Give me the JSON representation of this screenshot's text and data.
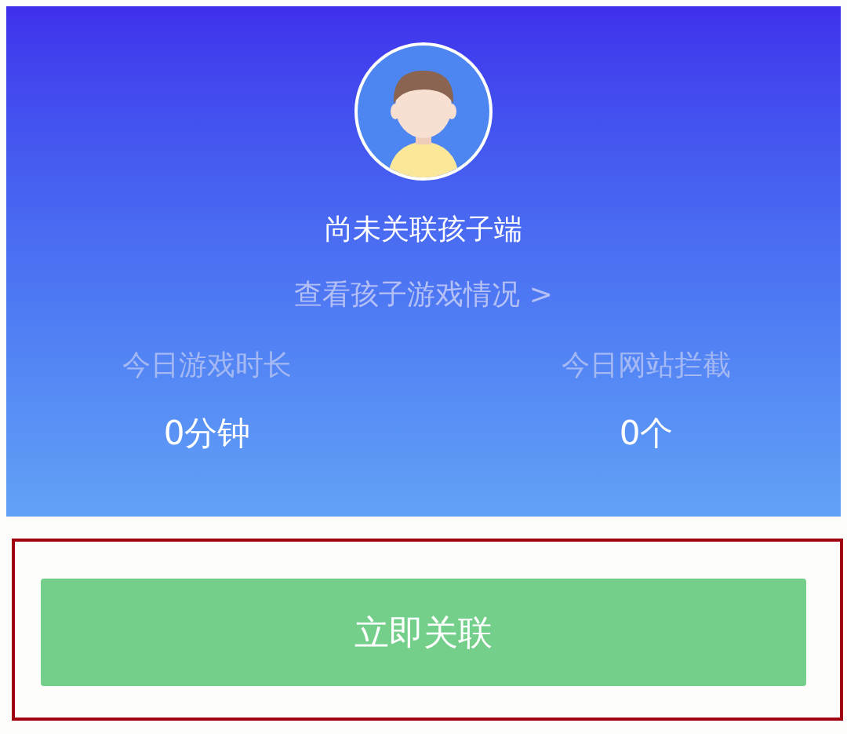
{
  "profile": {
    "status": "尚未关联孩子端",
    "link": "查看孩子游戏情况 >"
  },
  "stats": [
    {
      "label": "今日游戏时长",
      "value": "0分钟"
    },
    {
      "label": "今日网站拦截",
      "value": "0个"
    }
  ],
  "button": "立即关联"
}
